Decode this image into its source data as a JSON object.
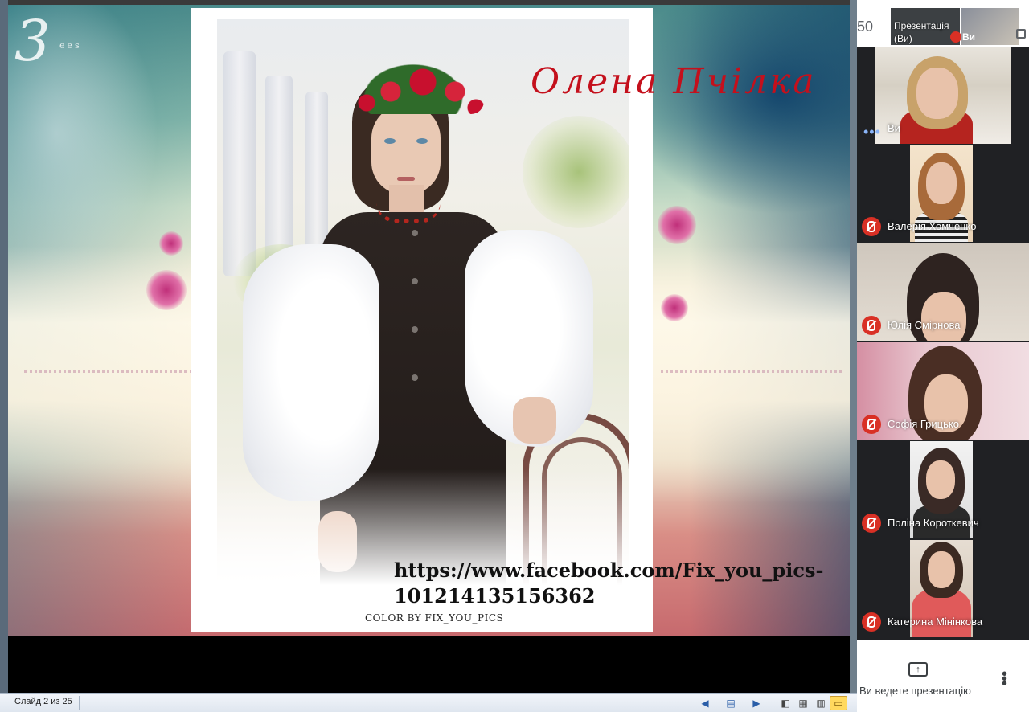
{
  "slide": {
    "title": "Олена Пчілка",
    "credit_url": "https://www.facebook.com/Fix_you_pics-101214135156362",
    "credit_color": "COLOR BY FIX_YOU_PICS",
    "logo_small": "ees"
  },
  "status_bar": {
    "slide_position": "Слайд 2 из 25"
  },
  "meet": {
    "participant_count": "50",
    "presentation_tile_label": "Презентація (Ви)",
    "me_mini_label": "Ви",
    "participants": [
      {
        "name": "Ви",
        "muted": false
      },
      {
        "name": "Валерія Хомченко",
        "muted": true
      },
      {
        "name": "Юлія Смірнова",
        "muted": true
      },
      {
        "name": "Софія Грицько",
        "muted": true
      },
      {
        "name": "Поліна Короткевич",
        "muted": true
      },
      {
        "name": "Катерина Мінінкова",
        "muted": true
      }
    ],
    "presenting_label": "Ви ведете презентацію"
  },
  "colors": {
    "title_red": "#c4101c",
    "mute_red": "#d93025",
    "meet_dark": "#202124",
    "active_view_yellow": "#ffd95e"
  }
}
